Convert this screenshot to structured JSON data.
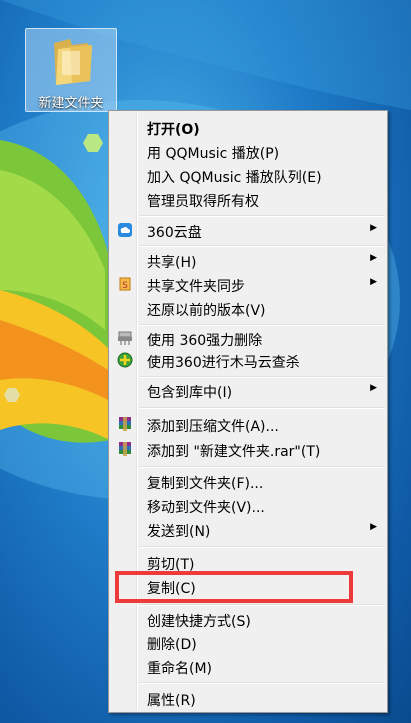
{
  "desktop": {
    "folder_label": "新建文件夹"
  },
  "menu": {
    "open": "打开(O)",
    "play_qqmusic": "用 QQMusic 播放(P)",
    "add_qqmusic_queue": "加入 QQMusic 播放队列(E)",
    "take_ownership": "管理员取得所有权",
    "cloud_360": "360云盘",
    "share": "共享(H)",
    "sync_shared_folder": "共享文件夹同步",
    "restore_versions": "还原以前的版本(V)",
    "force_delete_360": "使用 360强力删除",
    "trojan_scan_360": "使用360进行木马云查杀",
    "include_library": "包含到库中(I)",
    "add_archive": "添加到压缩文件(A)...",
    "add_to_rar": "添加到 \"新建文件夹.rar\"(T)",
    "copy_to_folder": "复制到文件夹(F)...",
    "move_to_folder": "移动到文件夹(V)...",
    "send_to": "发送到(N)",
    "cut": "剪切(T)",
    "copy": "复制(C)",
    "create_shortcut": "创建快捷方式(S)",
    "delete": "删除(D)",
    "rename": "重命名(M)",
    "properties": "属性(R)"
  },
  "colors": {
    "highlight": "#ee3a3a",
    "menu_bg": "#f0f0f0"
  }
}
